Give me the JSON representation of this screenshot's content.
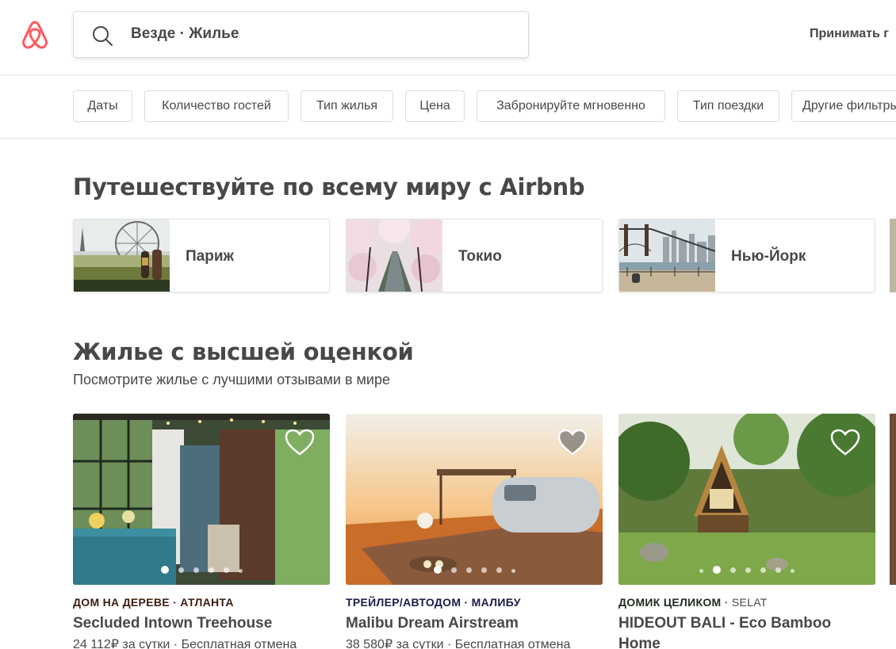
{
  "header": {
    "search_text": "Везде · Жилье",
    "host_link": "Принимать г"
  },
  "filters": [
    "Даты",
    "Количество гостей",
    "Тип жилья",
    "Цена",
    "Забронируйте мгновенно",
    "Тип поездки",
    "Другие фильтры"
  ],
  "travel": {
    "title": "Путешествуйте по всему миру с Airbnb",
    "destinations": [
      {
        "label": "Париж"
      },
      {
        "label": "Токио"
      },
      {
        "label": "Нью-Йорк"
      }
    ]
  },
  "top_rated": {
    "title": "Жилье с высшей оценкой",
    "subtitle": "Посмотрите жилье с лучшими отзывами в мире",
    "listings": [
      {
        "type": "ДОМ НА ДЕРЕВЕ",
        "location": "АТЛАНТА",
        "title": "Secluded Intown Treehouse",
        "price": "24 112₽",
        "per": "за сутки",
        "cancel": "Бесплатная отмена",
        "type_color": "#3c1e10",
        "heart": "outline"
      },
      {
        "type": "ТРЕЙЛЕР/АВТОДОМ",
        "location": "МАЛИБУ",
        "title": "Malibu Dream Airstream",
        "price": "38 580₽",
        "per": "за сутки",
        "cancel": "Бесплатная отмена",
        "type_color": "#1b1b4a",
        "heart": "filled"
      },
      {
        "type": "ДОМИК ЦЕЛИКОМ",
        "location": "SELAT",
        "title": "HIDEOUT BALI - Eco Bamboo Home",
        "price": "",
        "per": "",
        "cancel": "",
        "type_color": "#1f2a1f",
        "heart": "outline"
      }
    ]
  },
  "colors": {
    "brand": "#ff5a5f",
    "text": "#484848",
    "border": "#dcdcdc"
  }
}
